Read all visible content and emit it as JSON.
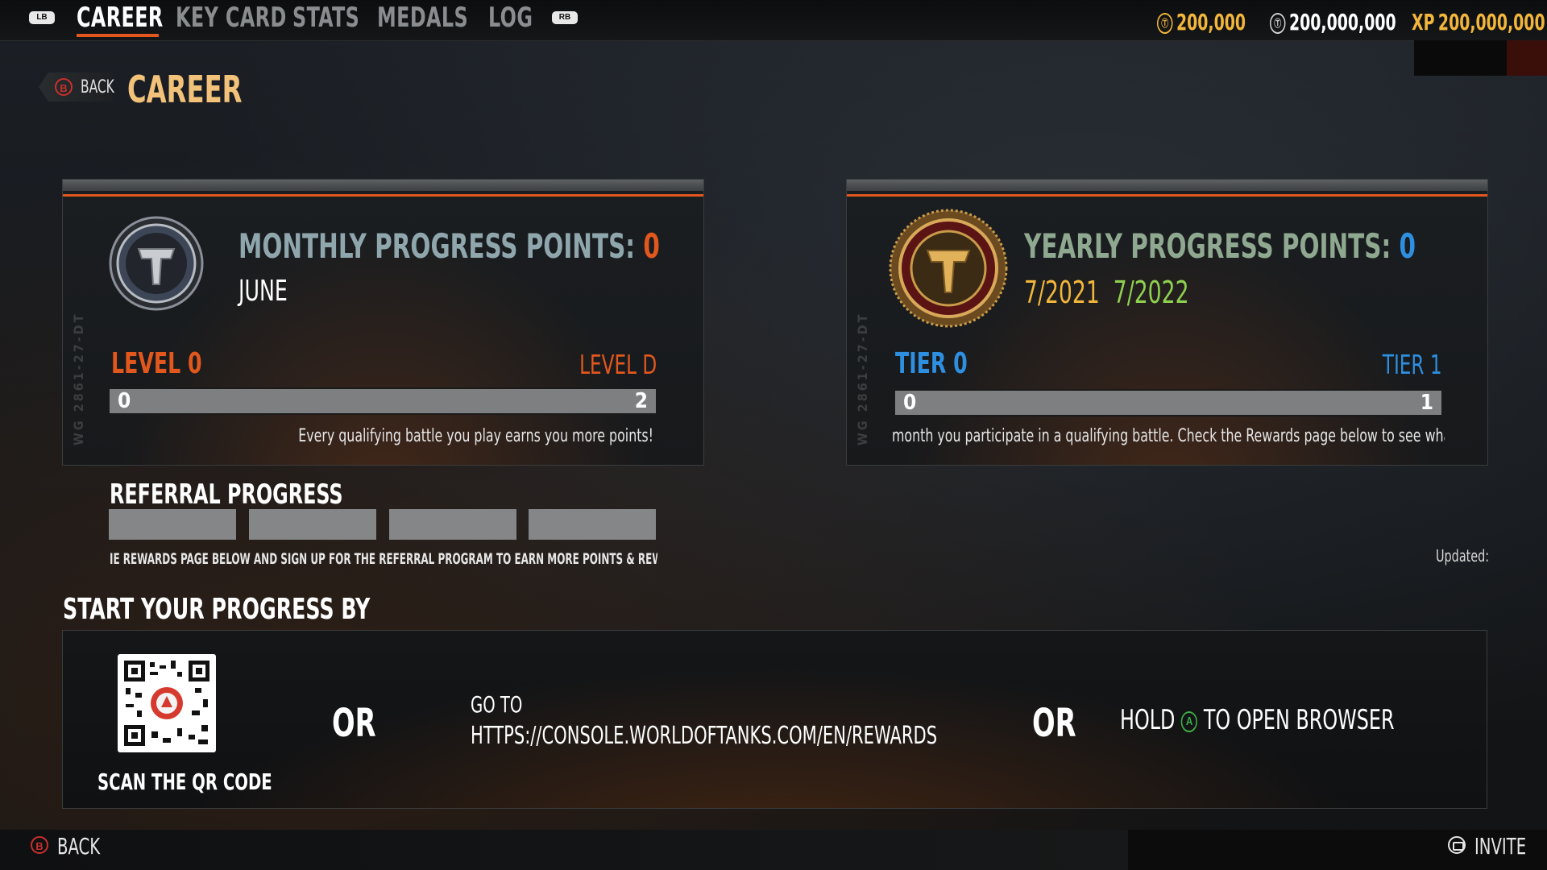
{
  "topbar": {
    "lb": "LB",
    "rb": "RB",
    "tabs": [
      {
        "label": "CAREER",
        "active": true
      },
      {
        "label": "KEY CARD",
        "active": false
      },
      {
        "label": "STATS",
        "active": false
      },
      {
        "label": "MEDALS",
        "active": false
      },
      {
        "label": "LOG",
        "active": false
      }
    ],
    "gold": "200,000",
    "credits": "200,000,000",
    "xp_label": "XP",
    "xp": "200,000,000"
  },
  "header": {
    "back_badge": "B",
    "back_label": "BACK",
    "title": "CAREER"
  },
  "monthly": {
    "label": "MONTHLY PROGRESS POINTS:",
    "points": "0",
    "month": "JUNE",
    "level_left": "LEVEL 0",
    "level_right": "LEVEL D",
    "bar_start": "0",
    "bar_end": "2",
    "progress": 0,
    "note": "Every qualifying battle you play earns you more points!",
    "watermark": "WG 2861-27-DT"
  },
  "yearly": {
    "label": "YEARLY PROGRESS POINTS:",
    "points": "0",
    "date_start": "7/2021",
    "date_end": "7/2022",
    "tier_left": "TIER 0",
    "tier_right": "TIER 1",
    "bar_start": "0",
    "bar_end": "1",
    "progress": 0,
    "note": "month you participate in a qualifying battle. Check the Rewards page below to see what you'r",
    "watermark": "WG 2861-27-DT"
  },
  "referral": {
    "title": "REFERRAL PROGRESS",
    "segments": 4,
    "note": "IE REWARDS PAGE BELOW AND SIGN UP FOR THE REFERRAL PROGRAM TO EARN MORE POINTS & REWARDS",
    "updated": "Updated:"
  },
  "start": {
    "title": "START YOUR PROGRESS BY",
    "qr_label": "SCAN THE QR CODE",
    "or1": "OR",
    "goto": "GO TO",
    "url": "HTTPS://CONSOLE.WORLDOFTANKS.COM/EN/REWARDS",
    "or2": "OR",
    "hold": "HOLD",
    "a_button": "A",
    "open_browser": "TO OPEN BROWSER"
  },
  "footer": {
    "back_badge": "B",
    "back_label": "BACK",
    "invite_label": "INVITE"
  },
  "colors": {
    "accent": "#e2571d",
    "gold": "#f2b63a",
    "blue": "#2e8fe0",
    "green": "#8fd14f",
    "monthly_label": "#8fa6ad",
    "yearly_label": "#8fa890"
  }
}
